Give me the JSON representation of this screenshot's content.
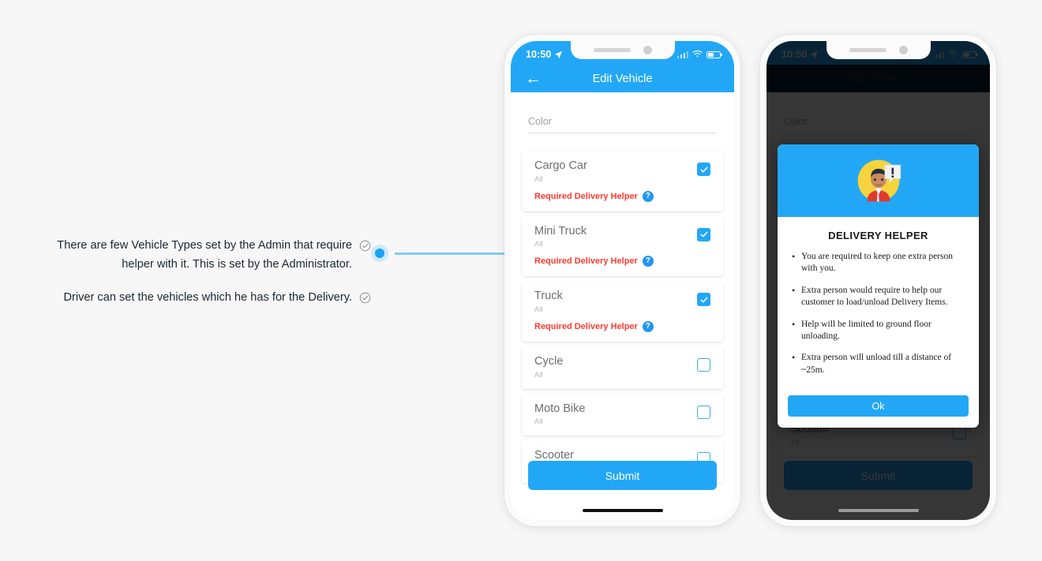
{
  "annotations": {
    "lines": [
      "There are few Vehicle Types set by the Admin that require helper with it. This is set by the Administrator.",
      "Driver can set the vehicles which he has for the Delivery."
    ]
  },
  "phone1": {
    "status": {
      "time": "10:50"
    },
    "nav": {
      "back": "←",
      "title": "Edit Vehicle"
    },
    "color_field": {
      "placeholder": "Color"
    },
    "vehicles": [
      {
        "name": "Cargo Car",
        "sub": "All",
        "checked": true,
        "helper": "Required Delivery Helper",
        "help_icon": "?"
      },
      {
        "name": "Mini Truck",
        "sub": "All",
        "checked": true,
        "helper": "Required Delivery Helper",
        "help_icon": "?"
      },
      {
        "name": "Truck",
        "sub": "All",
        "checked": true,
        "helper": "Required Delivery Helper",
        "help_icon": "?"
      },
      {
        "name": "Cycle",
        "sub": "All",
        "checked": false,
        "helper": "",
        "help_icon": ""
      },
      {
        "name": "Moto Bike",
        "sub": "All",
        "checked": false,
        "helper": "",
        "help_icon": ""
      },
      {
        "name": "Scooter",
        "sub": "All",
        "checked": false,
        "helper": "",
        "help_icon": ""
      }
    ],
    "submit_label": "Submit"
  },
  "phone2": {
    "status": {
      "time": "10:50"
    },
    "nav": {
      "back": "←",
      "title": "Edit Vehicle"
    },
    "color_field": {
      "placeholder": "Color"
    },
    "behind": {
      "vehicle_name": "Scooter",
      "vehicle_sub": "All"
    },
    "submit_label": "Submit",
    "modal": {
      "title": "DELIVERY HELPER",
      "bullets": [
        "You are required to keep one extra person with you.",
        "Extra person would require to help our customer to load/unload Delivery Items.",
        "Help will be limited to ground floor unloading.",
        "Extra person will unload till a distance of ~25m."
      ],
      "ok_label": "Ok"
    }
  },
  "colors": {
    "accent": "#22a7f7",
    "danger": "#ff3b30",
    "page_bg": "#f7f7f7",
    "hero_bg": "#22a7f7",
    "avatar_circle": "#f5d33c",
    "line": "#7ecbf7",
    "dot": "#1aa3f5"
  }
}
